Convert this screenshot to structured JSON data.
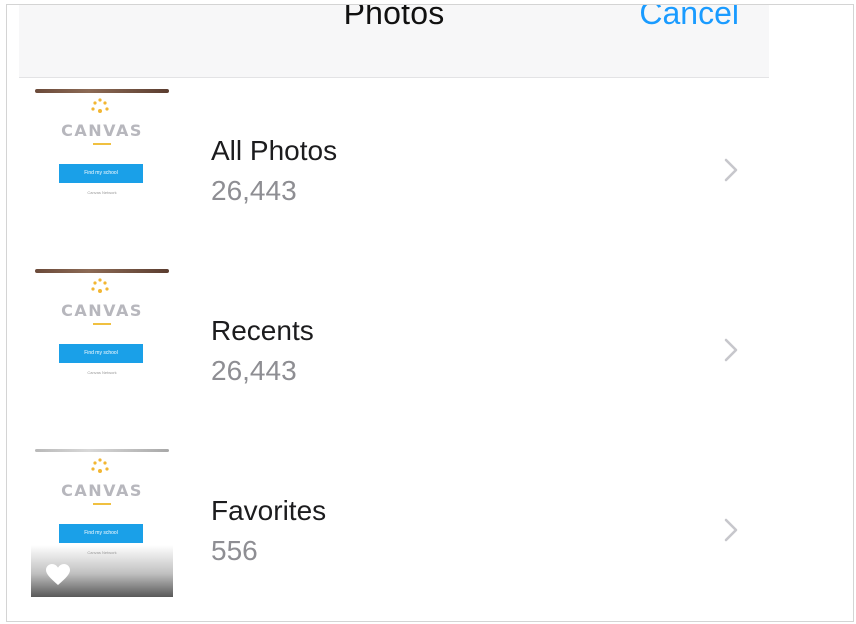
{
  "header": {
    "title": "Photos",
    "cancel_label": "Cancel"
  },
  "albums": [
    {
      "name": "All Photos",
      "count": "26,443",
      "thumbnail": {
        "logo_text": "CANVAS",
        "button_label": "Find my school",
        "link_text": "Canvas Network",
        "favorite": false
      }
    },
    {
      "name": "Recents",
      "count": "26,443",
      "thumbnail": {
        "logo_text": "CANVAS",
        "button_label": "Find my school",
        "link_text": "Canvas Network",
        "favorite": false
      }
    },
    {
      "name": "Favorites",
      "count": "556",
      "thumbnail": {
        "logo_text": "CANVAS",
        "button_label": "Find my school",
        "link_text": "Canvas Network",
        "favorite": true
      }
    }
  ],
  "icons": {
    "chevron": "chevron-right-icon",
    "heart": "heart-icon",
    "logo": "canvas-sun-logo-icon"
  },
  "colors": {
    "accent": "#1a9bff",
    "navbar_bg": "#f7f7f8",
    "secondary_text": "#8e8e93",
    "primary_text": "#1c1c1e",
    "thumb_button": "#1aa0e8"
  }
}
